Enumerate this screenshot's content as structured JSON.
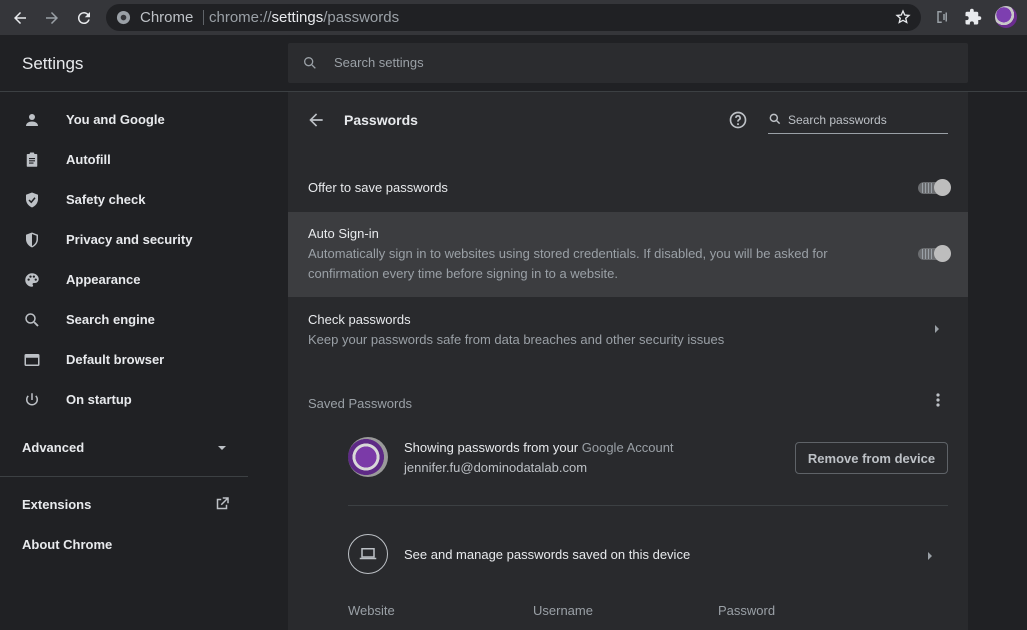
{
  "browser": {
    "omnibox_label": "Chrome",
    "url_prefix": "chrome://",
    "url_host": "settings",
    "url_path": "/passwords",
    "profile_color": "#7d3fb0"
  },
  "header": {
    "title": "Settings",
    "search_placeholder": "Search settings"
  },
  "sidebar": {
    "items": [
      {
        "label": "You and Google",
        "icon": "person-icon"
      },
      {
        "label": "Autofill",
        "icon": "clipboard-icon"
      },
      {
        "label": "Safety check",
        "icon": "shield-check-icon"
      },
      {
        "label": "Privacy and security",
        "icon": "shield-icon"
      },
      {
        "label": "Appearance",
        "icon": "palette-icon"
      },
      {
        "label": "Search engine",
        "icon": "search-icon"
      },
      {
        "label": "Default browser",
        "icon": "browser-icon"
      },
      {
        "label": "On startup",
        "icon": "power-icon"
      }
    ],
    "advanced": "Advanced",
    "extensions": "Extensions",
    "about": "About Chrome"
  },
  "passwords": {
    "title": "Passwords",
    "search_placeholder": "Search passwords",
    "offer_to_save": {
      "title": "Offer to save passwords",
      "enabled": true
    },
    "auto_signin": {
      "title": "Auto Sign-in",
      "description": "Automatically sign in to websites using stored credentials. If disabled, you will be asked for confirmation every time before signing in to a website.",
      "enabled": true
    },
    "check": {
      "title": "Check passwords",
      "description": "Keep your passwords safe from data breaches and other security issues"
    },
    "saved_section_title": "Saved Passwords",
    "account": {
      "showing_prefix": "Showing passwords from your ",
      "account_link": "Google Account",
      "email": "jennifer.fu@dominodatalab.com",
      "remove_button": "Remove from device"
    },
    "manage_device": "See and manage passwords saved on this device",
    "columns": [
      "Website",
      "Username",
      "Password"
    ]
  }
}
